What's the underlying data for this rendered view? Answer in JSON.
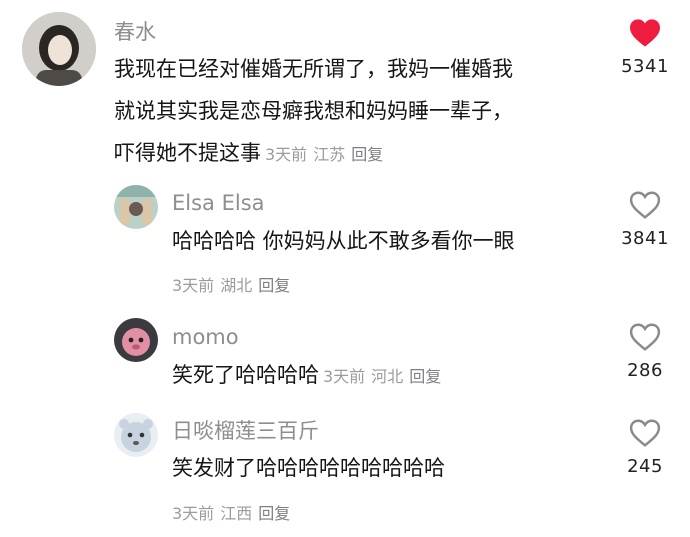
{
  "comments": [
    {
      "username": "春水",
      "lines": [
        "我现在已经对催婚无所谓了，我妈一催婚我",
        "就说其实我是恋母癖我想和妈妈睡一辈子，",
        "吓得她不提这事"
      ],
      "time": "3天前",
      "location": "江苏",
      "reply": "回复",
      "likes": "5341",
      "liked": true
    },
    {
      "username": "Elsa Elsa",
      "text": "哈哈哈哈 你妈妈从此不敢多看你一眼",
      "time": "3天前",
      "location": "湖北",
      "reply": "回复",
      "likes": "3841",
      "liked": false
    },
    {
      "username": "momo",
      "text": "笑死了哈哈哈哈",
      "time": "3天前",
      "location": "河北",
      "reply": "回复",
      "likes": "286",
      "liked": false
    },
    {
      "username": "日啖榴莲三百斤",
      "text": "笑发财了哈哈哈哈哈哈哈哈哈",
      "time": "3天前",
      "location": "江西",
      "reply": "回复",
      "likes": "245",
      "liked": false
    }
  ],
  "colors": {
    "heart_liked": "#ee1d3f",
    "heart_outline": "#8a8a8a"
  }
}
